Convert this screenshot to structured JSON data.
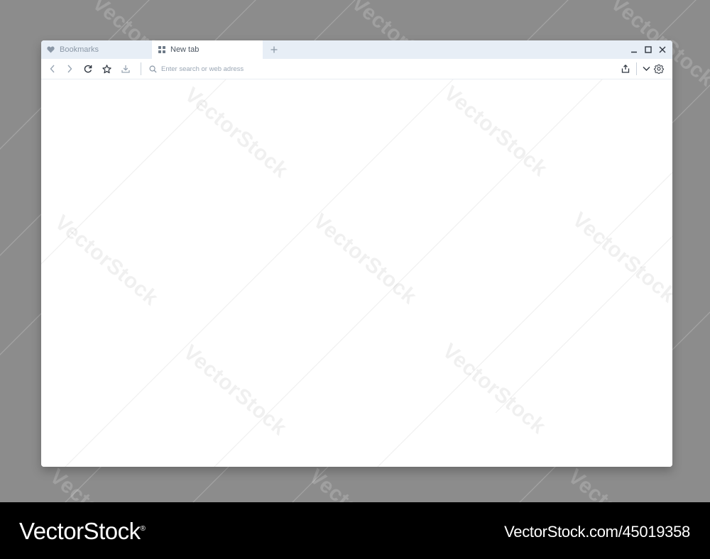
{
  "tabs": [
    {
      "label": "Bookmarks",
      "icon": "heart-icon",
      "active": false
    },
    {
      "label": "New tab",
      "icon": "grid-icon",
      "active": true
    }
  ],
  "new_tab_icon": "plus-icon",
  "window_controls": [
    "minimize-icon",
    "maximize-icon",
    "close-icon"
  ],
  "toolbar": {
    "buttons": [
      "back-icon",
      "forward-icon",
      "reload-icon",
      "star-icon",
      "download-icon"
    ],
    "right_buttons": [
      "share-icon",
      "chevron-down-icon",
      "gear-icon"
    ]
  },
  "address_bar": {
    "value": "",
    "placeholder": "Enter search or web adress",
    "icon": "search-icon"
  },
  "watermark": {
    "text": "VectorStock"
  },
  "footer": {
    "brand": "VectorStock",
    "brand_mark": "®",
    "image_id": "VectorStock.com/45019358"
  },
  "colors": {
    "background": "#8c8c8c",
    "tab_bar": "#e7eef6",
    "icon": "#4a5460",
    "icon_muted": "#9aa6b4",
    "footer": "#000000"
  }
}
